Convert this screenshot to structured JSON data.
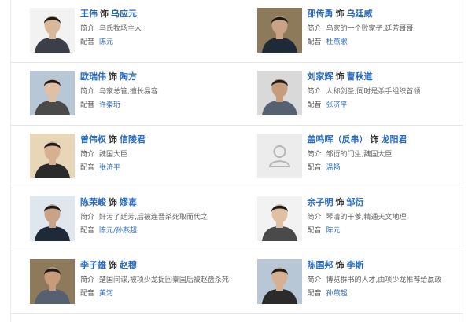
{
  "labels": {
    "intro": "简介",
    "voice": "配音",
    "plays": "饰"
  },
  "cast": [
    {
      "actor": "王伟",
      "role": "乌应元",
      "intro": "乌氏牧场主人",
      "voice": "陈元",
      "photo": "actor-portrait-photo"
    },
    {
      "actor": "邵传勇",
      "role": "乌廷威",
      "intro": "乌家的一个败家子,廷芳哥哥",
      "voice": "杜燕歌",
      "photo": "actor-portrait-photo"
    },
    {
      "actor": "欧瑞伟",
      "role": "陶方",
      "intro": "乌家总管,擅长易容",
      "voice": "许秦珩",
      "photo": "actor-portrait-photo"
    },
    {
      "actor": "刘家辉",
      "role": "曹秋道",
      "intro": "人称剑圣,同时是杀手组织首领",
      "voice": "张济平",
      "photo": "actor-portrait-photo"
    },
    {
      "actor": "曾伟权",
      "role": "信陵君",
      "intro": "魏国大臣",
      "voice": "张济平",
      "photo": "actor-portrait-photo"
    },
    {
      "actor": "盖鸣晖（反串）",
      "role": "龙阳君",
      "intro": "邹衍的门生,魏国大臣",
      "voice": "温畅",
      "photo": "placeholder-avatar-icon"
    },
    {
      "actor": "陈荣峻",
      "role": "嫪毐",
      "intro": "奸污了廷芳,后被连晋杀死取而代之",
      "voice": "陈元/孙燕超",
      "photo": "actor-portrait-photo"
    },
    {
      "actor": "余子明",
      "role": "邹衍",
      "intro": "琴清的干爹,精通天文地理",
      "voice": "陈元",
      "photo": "actor-portrait-photo"
    },
    {
      "actor": "李子雄",
      "role": "赵穆",
      "intro": "楚国间谍,被项少龙捉回秦国后被赵盘杀死",
      "voice": "黄河",
      "photo": "actor-portrait-photo"
    },
    {
      "actor": "陈国邦",
      "role": "李斯",
      "intro": "博览群书的人才,由项少龙推荐给嬴政",
      "voice": "孙燕超",
      "photo": "actor-portrait-photo"
    }
  ]
}
